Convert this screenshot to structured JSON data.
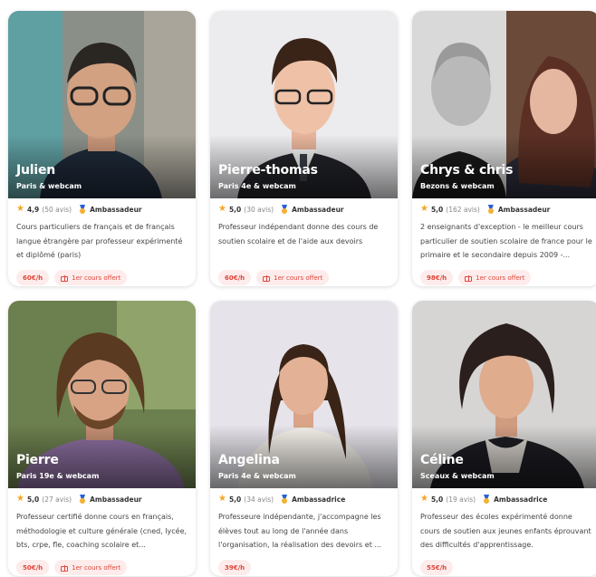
{
  "colors": {
    "accent": "#e0473d",
    "tag_bg": "#fdeceb",
    "star": "#f5a623"
  },
  "icons": {
    "rating": "star-icon",
    "badge": "medal-icon",
    "gift": "gift-icon"
  },
  "cards": [
    {
      "name": "Julien",
      "location": "Paris & webcam",
      "rating": "4,9",
      "reviews": "(50 avis)",
      "badge": "Ambassadeur",
      "description": "Cours particuliers de français et de français langue étrangère par professeur expérimenté et diplômé (paris)",
      "price": "60€/h",
      "offer": "1er cours offert"
    },
    {
      "name": "Pierre-thomas",
      "location": "Paris 4e & webcam",
      "rating": "5,0",
      "reviews": "(30 avis)",
      "badge": "Ambassadeur",
      "description": "Professeur indépendant donne des cours de soutien scolaire et de l'aide aux devoirs",
      "price": "60€/h",
      "offer": "1er cours offert"
    },
    {
      "name": "Chrys & chris",
      "location": "Bezons & webcam",
      "rating": "5,0",
      "reviews": "(162 avis)",
      "badge": "Ambassadeur",
      "description": "2 enseignants d'exception - le meilleur cours particulier de soutien scolaire de france pour le primaire et le secondaire depuis 2009 -...",
      "price": "98€/h",
      "offer": "1er cours offert"
    },
    {
      "name": "Pierre",
      "location": "Paris 19e & webcam",
      "rating": "5,0",
      "reviews": "(27 avis)",
      "badge": "Ambassadeur",
      "description": "Professeur certifié donne cours en français, méthodologie et culture générale (cned, lycée, bts, crpe, fle, coaching scolaire et...",
      "price": "50€/h",
      "offer": "1er cours offert"
    },
    {
      "name": "Angelina",
      "location": "Paris 4e & webcam",
      "rating": "5,0",
      "reviews": "(34 avis)",
      "badge": "Ambassadrice",
      "description": "Professeure indépendante, j'accompagne les élèves tout au long de l'année dans l'organisation, la réalisation des devoirs et ...",
      "price": "39€/h",
      "offer": ""
    },
    {
      "name": "Céline",
      "location": "Sceaux & webcam",
      "rating": "5,0",
      "reviews": "(19 avis)",
      "badge": "Ambassadrice",
      "description": "Professeur des écoles expérimenté donne cours de soutien aux jeunes enfants éprouvant des difficultés d'apprentissage.",
      "price": "55€/h",
      "offer": ""
    }
  ]
}
